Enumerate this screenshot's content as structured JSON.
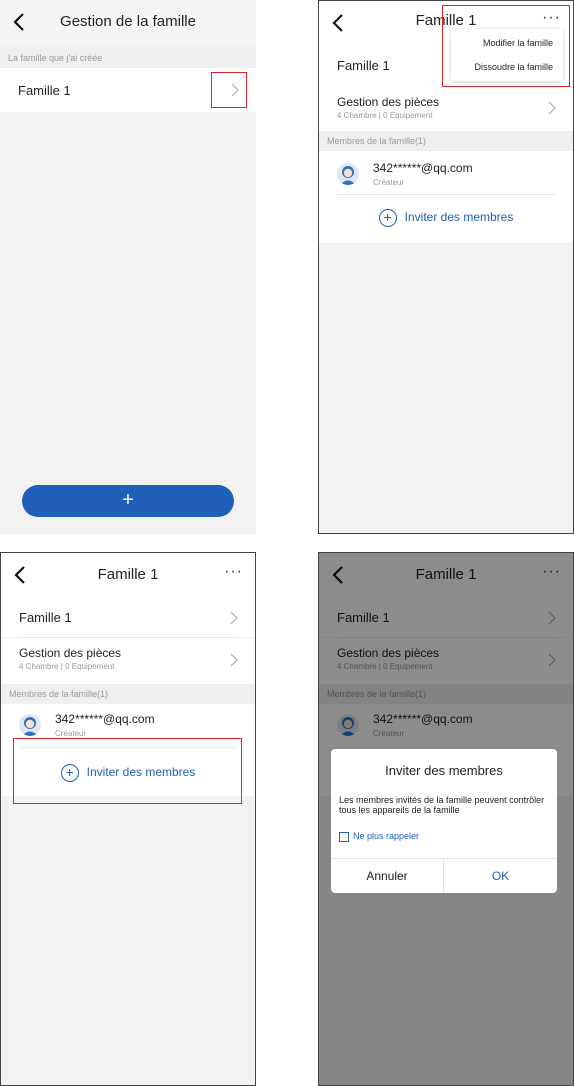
{
  "screen1": {
    "header_title": "Gestion de la famille",
    "section_label": "La famille que j'ai créée",
    "family_name": "Famille 1",
    "fab_label": "+"
  },
  "screen2": {
    "header_title": "Famille 1",
    "more_label": "···",
    "family_name": "Famille 1",
    "rooms_title": "Gestion des pièces",
    "rooms_sub": "4 Chambre | 0 Equipement",
    "members_label": "Membres de la famille(1)",
    "member_email": "342******@qq.com",
    "member_role": "Créateur",
    "invite_label": "Inviter des membres",
    "menu": {
      "edit": "Modifier la famille",
      "dissolve": "Dissoudre la famille"
    }
  },
  "screen3": {
    "header_title": "Famille 1",
    "more_label": "···",
    "family_name": "Famille 1",
    "rooms_title": "Gestion des pièces",
    "rooms_sub": "4 Chambre | 0 Equipement",
    "members_label": "Membres de la famille(1)",
    "member_email": "342******@qq.com",
    "member_role": "Créateur",
    "invite_label": "Inviter des membres"
  },
  "screen4": {
    "header_title": "Famille 1",
    "more_label": "···",
    "family_name": "Famille 1",
    "rooms_title": "Gestion des pièces",
    "rooms_sub": "4 Chambre | 0 Equipement",
    "members_label": "Membres de la famille(1)",
    "member_email": "342******@qq.com",
    "member_role": "Créateur",
    "dialog": {
      "title": "Inviter des membres",
      "message": "Les membres invités de la famille peuvent contrôler tous les appareils de la famille",
      "checkbox_label": "Ne plus rappeler",
      "cancel": "Annuler",
      "ok": "OK"
    }
  },
  "colors": {
    "accent": "#1f5fb8",
    "highlight": "#e0242b",
    "background": "#f2f2f2"
  }
}
